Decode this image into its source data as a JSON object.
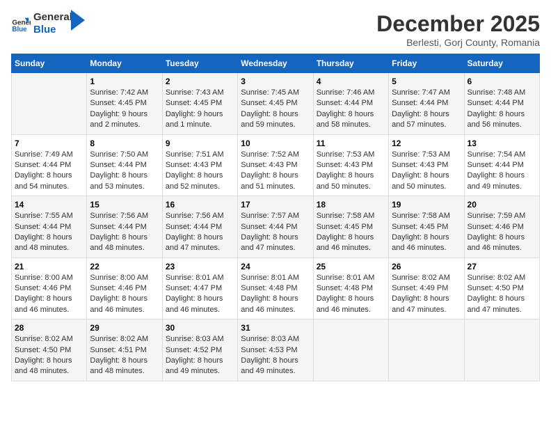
{
  "header": {
    "logo_line1": "General",
    "logo_line2": "Blue",
    "month_title": "December 2025",
    "location": "Berlesti, Gorj County, Romania"
  },
  "days_of_week": [
    "Sunday",
    "Monday",
    "Tuesday",
    "Wednesday",
    "Thursday",
    "Friday",
    "Saturday"
  ],
  "weeks": [
    [
      {
        "day": "",
        "sunrise": "",
        "sunset": "",
        "daylight": ""
      },
      {
        "day": "1",
        "sunrise": "Sunrise: 7:42 AM",
        "sunset": "Sunset: 4:45 PM",
        "daylight": "Daylight: 9 hours and 2 minutes."
      },
      {
        "day": "2",
        "sunrise": "Sunrise: 7:43 AM",
        "sunset": "Sunset: 4:45 PM",
        "daylight": "Daylight: 9 hours and 1 minute."
      },
      {
        "day": "3",
        "sunrise": "Sunrise: 7:45 AM",
        "sunset": "Sunset: 4:45 PM",
        "daylight": "Daylight: 8 hours and 59 minutes."
      },
      {
        "day": "4",
        "sunrise": "Sunrise: 7:46 AM",
        "sunset": "Sunset: 4:44 PM",
        "daylight": "Daylight: 8 hours and 58 minutes."
      },
      {
        "day": "5",
        "sunrise": "Sunrise: 7:47 AM",
        "sunset": "Sunset: 4:44 PM",
        "daylight": "Daylight: 8 hours and 57 minutes."
      },
      {
        "day": "6",
        "sunrise": "Sunrise: 7:48 AM",
        "sunset": "Sunset: 4:44 PM",
        "daylight": "Daylight: 8 hours and 56 minutes."
      }
    ],
    [
      {
        "day": "7",
        "sunrise": "Sunrise: 7:49 AM",
        "sunset": "Sunset: 4:44 PM",
        "daylight": "Daylight: 8 hours and 54 minutes."
      },
      {
        "day": "8",
        "sunrise": "Sunrise: 7:50 AM",
        "sunset": "Sunset: 4:44 PM",
        "daylight": "Daylight: 8 hours and 53 minutes."
      },
      {
        "day": "9",
        "sunrise": "Sunrise: 7:51 AM",
        "sunset": "Sunset: 4:43 PM",
        "daylight": "Daylight: 8 hours and 52 minutes."
      },
      {
        "day": "10",
        "sunrise": "Sunrise: 7:52 AM",
        "sunset": "Sunset: 4:43 PM",
        "daylight": "Daylight: 8 hours and 51 minutes."
      },
      {
        "day": "11",
        "sunrise": "Sunrise: 7:53 AM",
        "sunset": "Sunset: 4:43 PM",
        "daylight": "Daylight: 8 hours and 50 minutes."
      },
      {
        "day": "12",
        "sunrise": "Sunrise: 7:53 AM",
        "sunset": "Sunset: 4:43 PM",
        "daylight": "Daylight: 8 hours and 50 minutes."
      },
      {
        "day": "13",
        "sunrise": "Sunrise: 7:54 AM",
        "sunset": "Sunset: 4:44 PM",
        "daylight": "Daylight: 8 hours and 49 minutes."
      }
    ],
    [
      {
        "day": "14",
        "sunrise": "Sunrise: 7:55 AM",
        "sunset": "Sunset: 4:44 PM",
        "daylight": "Daylight: 8 hours and 48 minutes."
      },
      {
        "day": "15",
        "sunrise": "Sunrise: 7:56 AM",
        "sunset": "Sunset: 4:44 PM",
        "daylight": "Daylight: 8 hours and 48 minutes."
      },
      {
        "day": "16",
        "sunrise": "Sunrise: 7:56 AM",
        "sunset": "Sunset: 4:44 PM",
        "daylight": "Daylight: 8 hours and 47 minutes."
      },
      {
        "day": "17",
        "sunrise": "Sunrise: 7:57 AM",
        "sunset": "Sunset: 4:44 PM",
        "daylight": "Daylight: 8 hours and 47 minutes."
      },
      {
        "day": "18",
        "sunrise": "Sunrise: 7:58 AM",
        "sunset": "Sunset: 4:45 PM",
        "daylight": "Daylight: 8 hours and 46 minutes."
      },
      {
        "day": "19",
        "sunrise": "Sunrise: 7:58 AM",
        "sunset": "Sunset: 4:45 PM",
        "daylight": "Daylight: 8 hours and 46 minutes."
      },
      {
        "day": "20",
        "sunrise": "Sunrise: 7:59 AM",
        "sunset": "Sunset: 4:46 PM",
        "daylight": "Daylight: 8 hours and 46 minutes."
      }
    ],
    [
      {
        "day": "21",
        "sunrise": "Sunrise: 8:00 AM",
        "sunset": "Sunset: 4:46 PM",
        "daylight": "Daylight: 8 hours and 46 minutes."
      },
      {
        "day": "22",
        "sunrise": "Sunrise: 8:00 AM",
        "sunset": "Sunset: 4:46 PM",
        "daylight": "Daylight: 8 hours and 46 minutes."
      },
      {
        "day": "23",
        "sunrise": "Sunrise: 8:01 AM",
        "sunset": "Sunset: 4:47 PM",
        "daylight": "Daylight: 8 hours and 46 minutes."
      },
      {
        "day": "24",
        "sunrise": "Sunrise: 8:01 AM",
        "sunset": "Sunset: 4:48 PM",
        "daylight": "Daylight: 8 hours and 46 minutes."
      },
      {
        "day": "25",
        "sunrise": "Sunrise: 8:01 AM",
        "sunset": "Sunset: 4:48 PM",
        "daylight": "Daylight: 8 hours and 46 minutes."
      },
      {
        "day": "26",
        "sunrise": "Sunrise: 8:02 AM",
        "sunset": "Sunset: 4:49 PM",
        "daylight": "Daylight: 8 hours and 47 minutes."
      },
      {
        "day": "27",
        "sunrise": "Sunrise: 8:02 AM",
        "sunset": "Sunset: 4:50 PM",
        "daylight": "Daylight: 8 hours and 47 minutes."
      }
    ],
    [
      {
        "day": "28",
        "sunrise": "Sunrise: 8:02 AM",
        "sunset": "Sunset: 4:50 PM",
        "daylight": "Daylight: 8 hours and 48 minutes."
      },
      {
        "day": "29",
        "sunrise": "Sunrise: 8:02 AM",
        "sunset": "Sunset: 4:51 PM",
        "daylight": "Daylight: 8 hours and 48 minutes."
      },
      {
        "day": "30",
        "sunrise": "Sunrise: 8:03 AM",
        "sunset": "Sunset: 4:52 PM",
        "daylight": "Daylight: 8 hours and 49 minutes."
      },
      {
        "day": "31",
        "sunrise": "Sunrise: 8:03 AM",
        "sunset": "Sunset: 4:53 PM",
        "daylight": "Daylight: 8 hours and 49 minutes."
      },
      {
        "day": "",
        "sunrise": "",
        "sunset": "",
        "daylight": ""
      },
      {
        "day": "",
        "sunrise": "",
        "sunset": "",
        "daylight": ""
      },
      {
        "day": "",
        "sunrise": "",
        "sunset": "",
        "daylight": ""
      }
    ]
  ]
}
